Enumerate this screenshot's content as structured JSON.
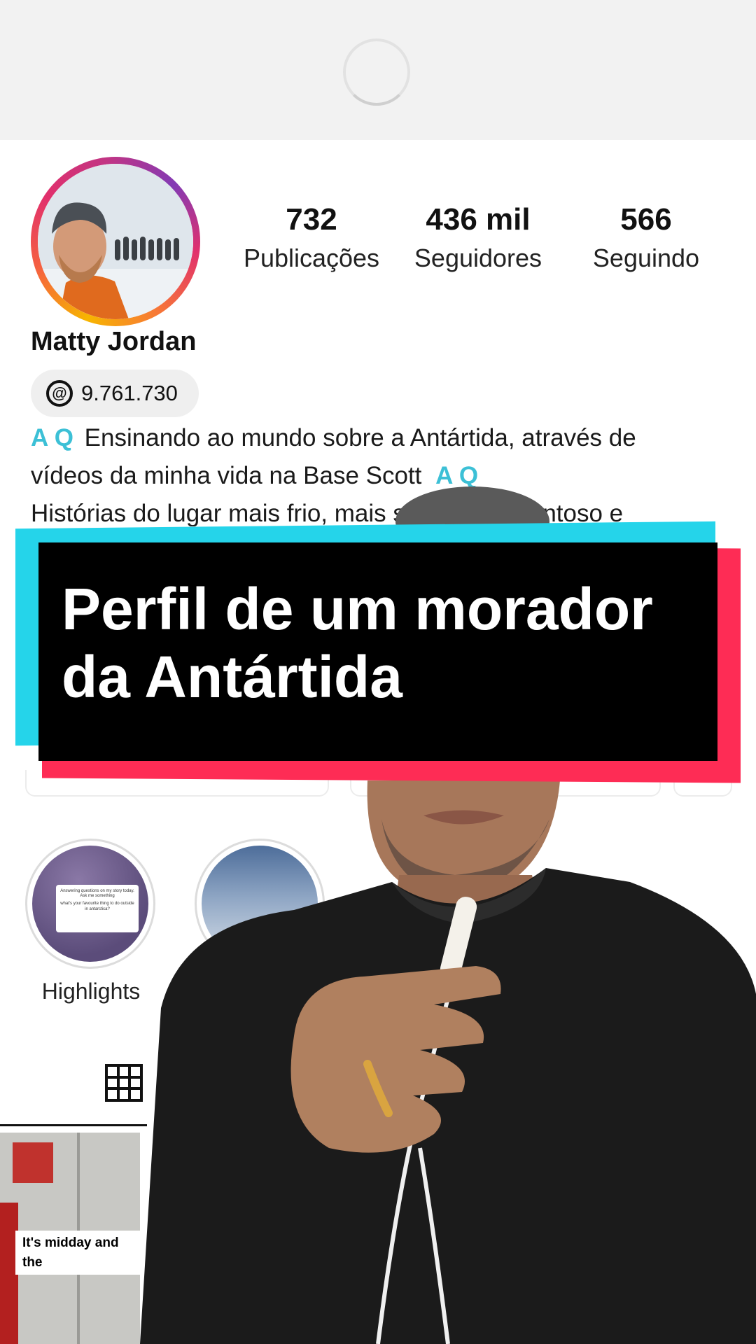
{
  "profile": {
    "name": "Matty Jordan",
    "threads_count": "9.761.730",
    "stats": [
      {
        "value": "732",
        "label": "Publicações"
      },
      {
        "value": "436 mil",
        "label": "Seguidores"
      },
      {
        "value": "566",
        "label": "Seguindo"
      }
    ],
    "bio": {
      "line1": "Ensinando ao mundo sobre a Antártida, através de",
      "line2": "vídeos da minha vida na Base Scott",
      "line3": "Histórias do lugar mais frio, mais seco, mais ventoso e",
      "marks": "A Q"
    }
  },
  "overlay_title": {
    "line1": "Perfil de um morador",
    "line2": "da Antártida"
  },
  "highlights": [
    {
      "label": "Highlights",
      "card_text": "Answering questions on my story today. Ask me something",
      "card_question": "what's your favourite thing to do outside in antarctica?"
    }
  ],
  "post": {
    "caption": "It's midday and the"
  },
  "icons": [
    "loading-spinner-icon",
    "threads-icon",
    "grid-icon"
  ],
  "colors": {
    "banner_cyan": "#25d4ea",
    "banner_red": "#fe2c55",
    "banner_fill": "#000000",
    "bio_marks": "#3cc0d6"
  }
}
